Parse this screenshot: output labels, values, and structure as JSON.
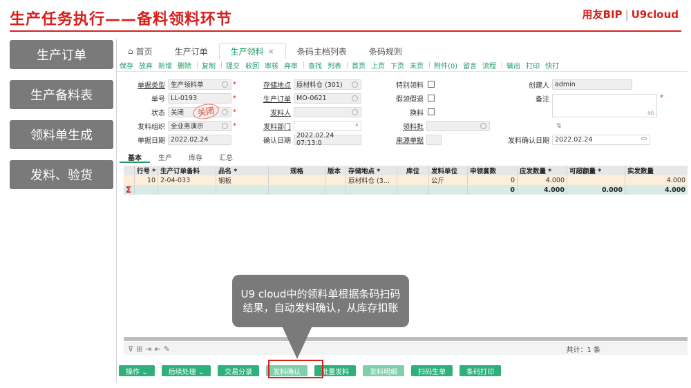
{
  "slide": {
    "title": "生产任务执行——备料领料环节",
    "brand_left": "用友BIP",
    "brand_sep": "|",
    "brand_right": "U9cloud"
  },
  "steps": [
    "生产订单",
    "生产备料表",
    "领料单生成",
    "发料、验货"
  ],
  "tabs": [
    {
      "label": "首页",
      "icon": "home-icon"
    },
    {
      "label": "生产订单"
    },
    {
      "label": "生产领料",
      "active": true
    },
    {
      "label": "条码主档列表"
    },
    {
      "label": "条码规则"
    }
  ],
  "tab_close": "×",
  "toolbar": [
    "保存",
    "放弃",
    "新增",
    "删除",
    "复制",
    "提交",
    "收回",
    "审核",
    "弃审",
    "查找",
    "列表",
    "首页",
    "上页",
    "下页",
    "末页",
    "附件(0)",
    "留言",
    "流程",
    "输出",
    "打印",
    "快打"
  ],
  "form": {
    "doc_type_label": "单据类型",
    "doc_type": "生产领料单",
    "doc_no_label": "单号",
    "doc_no": "LL-0193",
    "status_label": "状态",
    "status": "关闭",
    "stamp": "关闭",
    "issue_org_label": "发料组织",
    "issue_org": "全业务演示",
    "doc_date_label": "单据日期",
    "doc_date": "2022.02.24",
    "storage_label": "存储地点",
    "storage": "原材料仓 (301)",
    "mo_label": "生产订单",
    "mo": "MO-0621",
    "issuer_label": "发料人",
    "issuer": "",
    "issue_dept_label": "发料部门",
    "issue_dept": "",
    "confirm_date_label": "确认日期",
    "confirm_date": "2022.02.24 07:13:0",
    "special_label": "特别领料",
    "fake_label": "假领假退",
    "swap_label": "换料",
    "batch_label": "领料批",
    "source_label": "来源单据",
    "creator_label": "创建人",
    "creator": "admin",
    "remark_label": "备注",
    "remark_counter": "ab",
    "issue_confirm_date_label": "发料确认日期",
    "issue_confirm_date": "2022.02.24",
    "required_mark": "*"
  },
  "subtabs": [
    "基本",
    "生产",
    "库存",
    "汇总"
  ],
  "grid": {
    "headers": [
      "",
      "行号 *",
      "生产订单备料",
      "品名 *",
      "规格",
      "版本",
      "存储地点 *",
      "库位",
      "发料单位",
      "申领套数",
      "应发数量 *",
      "可超额量 *",
      "实发数量"
    ],
    "row": [
      "",
      "10",
      "2-04-033",
      "钢板",
      "",
      "",
      "原材料仓 (3...",
      "",
      "公斤",
      "0",
      "4.000",
      "",
      "4.000"
    ],
    "sum": [
      "Σ",
      "",
      "",
      "",
      "",
      "",
      "",
      "",
      "",
      "0",
      "4.000",
      "0.000",
      "4.000"
    ],
    "total": "共计：1 条"
  },
  "bottom_buttons": [
    {
      "label": "操作 ⌄"
    },
    {
      "label": "后续处理 ⌄"
    },
    {
      "label": "交易分录"
    },
    {
      "label": "发料确认",
      "light": true
    },
    {
      "label": "批量发料"
    },
    {
      "label": "发料明细",
      "light": true
    },
    {
      "label": "扫码生单"
    },
    {
      "label": "条码打印"
    }
  ],
  "callout": "U9 cloud中的领料单根据条码扫码结果，自动发料确认，从库存扣账"
}
